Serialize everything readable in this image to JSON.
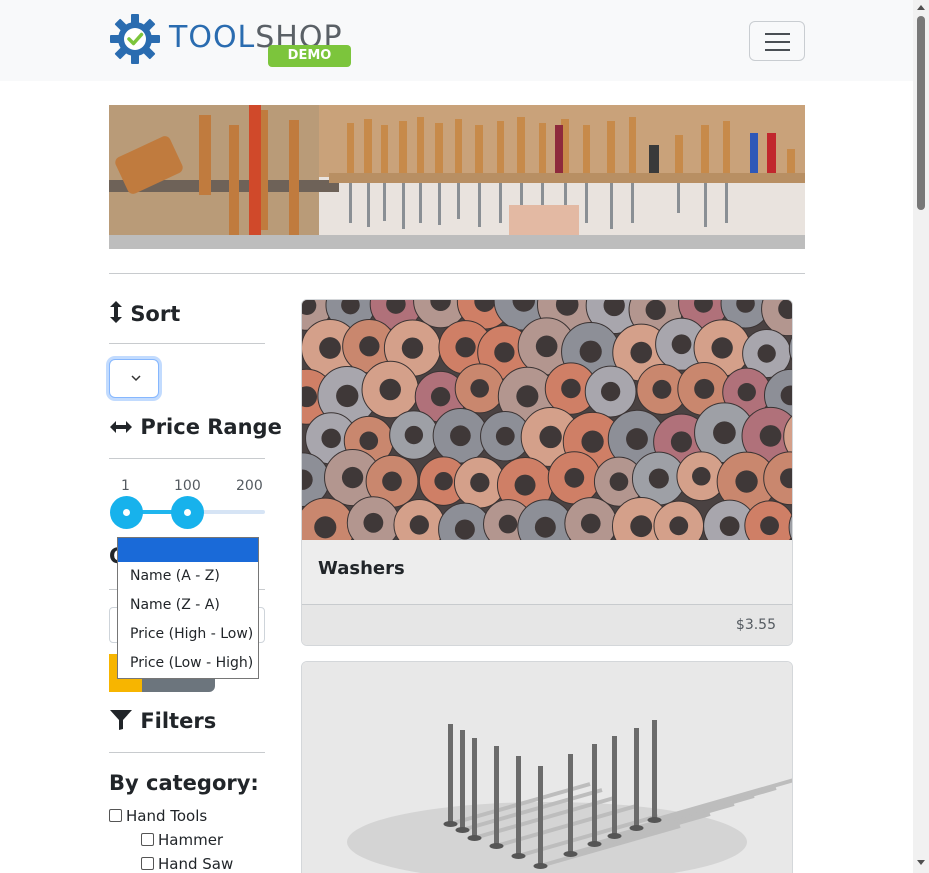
{
  "app": {
    "logo_word_1": "TOOL",
    "logo_word_2": "SHOP",
    "logo_badge": "DEMO",
    "brand_blue": "#2a6cb0",
    "brand_green": "#7cc53c",
    "nav_toggle_icon": "hamburger-menu-icon"
  },
  "sidebar": {
    "sort_heading": "Sort",
    "sort_icon": "up-down-arrow-icon",
    "sort_dropdown": {
      "options": [
        "",
        "Name (A - Z)",
        "Name (Z - A)",
        "Price (High - Low)",
        "Price (Low - High)"
      ],
      "highlight_color": "#1a6ad8"
    },
    "price_heading": "Price Range",
    "price_icon": "left-right-arrow-icon",
    "price_slider": {
      "min_label": "1",
      "value_label": "100",
      "max_label": "200",
      "selected_min": 1,
      "selected_max": 100,
      "accent": "#17b2ec"
    },
    "filters_heading": "Filters",
    "filters_icon": "funnel-icon",
    "category_heading": "By category:",
    "categories": [
      {
        "label": "Hand Tools",
        "checked": false
      },
      {
        "label": "Hammer",
        "checked": false
      },
      {
        "label": "Hand Saw",
        "checked": false
      }
    ]
  },
  "products": [
    {
      "name": "Washers",
      "price": "$3.55",
      "image": "washers-photo"
    },
    {
      "name": "",
      "price": "",
      "image": "screws-photo"
    }
  ]
}
